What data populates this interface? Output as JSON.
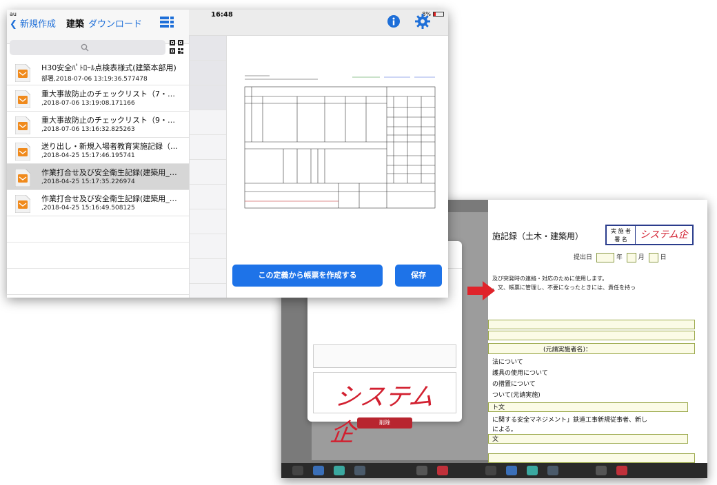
{
  "status_bar": {
    "carrier": "au",
    "time": "16:48",
    "battery": "8%"
  },
  "nav": {
    "back_label": "新規作成",
    "title": "建築",
    "download_label": "ダウンロード"
  },
  "search": {
    "placeholder": ""
  },
  "files": [
    {
      "title": "H30安全ﾊﾟﾄﾛｰﾙ点検表様式(建築本部用)",
      "subtitle": "部署,2018-07-06 13:19:36.577478"
    },
    {
      "title": "重大事故防止のチェックリスト（7・8…",
      "subtitle": ",2018-07-06 13:19:08.171166"
    },
    {
      "title": "重大事故防止のチェックリスト（9・1…",
      "subtitle": ",2018-07-06 13:16:32.825263"
    },
    {
      "title": "送り出し・新規入場者教育実施記録（…",
      "subtitle": ",2018-04-25 15:17:46.195741"
    },
    {
      "title": "作業打合せ及び安全衛生記録(建築用_…",
      "subtitle": ",2018-04-25 15:17:35.226974"
    },
    {
      "title": "作業打合せ及び安全衛生記録(建築用_…",
      "subtitle": ",2018-04-25 15:16:49.508125"
    }
  ],
  "actions": {
    "create_label": "この定義から帳票を作成する",
    "save_label": "保存"
  },
  "back_screen": {
    "doc_title": "施記録（土木・建築用）",
    "stamp_label": "実 施 者署 名",
    "stamp_value": "システム企",
    "submit_label": "提出日",
    "year": "年",
    "month": "月",
    "day": "日",
    "note1": "及び突発時の連絡・対応のために使用します。",
    "note2": "、又、帳票に管理し、不要になったときには、責任を持っ",
    "main_contractor": "(元請実施者名)：",
    "items": [
      "法について",
      "護具の使用について",
      "の措置について",
      "ついて(元請実施)",
      "ト文",
      "に関する安全マネジメント」鉄道工事新規従事者、新し",
      "による。",
      "文"
    ],
    "signature": "システム企",
    "delete_label": "削除"
  },
  "colors": {
    "accent": "#1e73e8",
    "signature": "#d22030",
    "arrow": "#e0232a"
  }
}
